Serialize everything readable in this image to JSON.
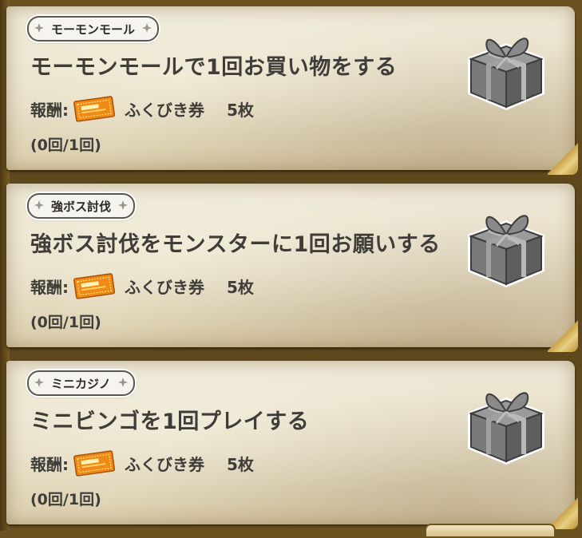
{
  "missions": [
    {
      "category": "モーモンモール",
      "title": "モーモンモールで1回お買い物をする",
      "reward_label": "報酬:",
      "reward_item": "ふくびき券",
      "reward_qty": "5枚",
      "progress": "(0回/1回)"
    },
    {
      "category": "強ボス討伐",
      "title": "強ボス討伐をモンスターに1回お願いする",
      "reward_label": "報酬:",
      "reward_item": "ふくびき券",
      "reward_qty": "5枚",
      "progress": "(0回/1回)"
    },
    {
      "category": "ミニカジノ",
      "title": "ミニビンゴを1回プレイする",
      "reward_label": "報酬:",
      "reward_item": "ふくびき券",
      "reward_qty": "5枚",
      "progress": "(0回/1回)"
    }
  ],
  "icons": {
    "reward_item_icon": "ticket-icon",
    "mission_reward_box": "gift-box-icon",
    "tag_ornament": "ornament-icon"
  },
  "colors": {
    "ticket": "#f08a14",
    "gift_box": "#6f6f6f",
    "parchment": "#e6ddc5",
    "text": "#3f3d3a"
  }
}
